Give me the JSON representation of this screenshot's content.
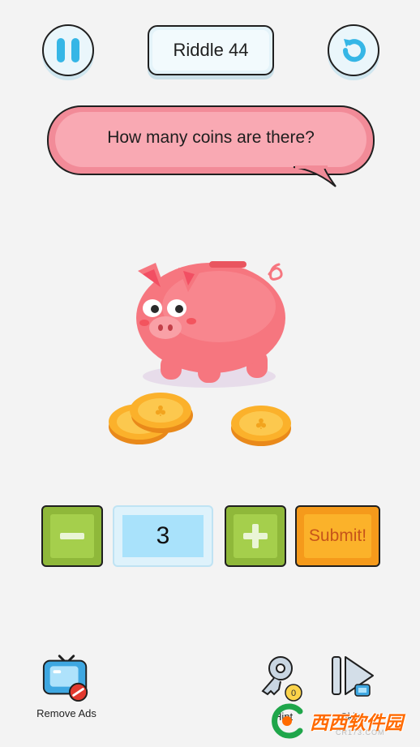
{
  "header": {
    "title": "Riddle 44"
  },
  "question": {
    "text": "How many coins are there?"
  },
  "answer": {
    "value": "3"
  },
  "controls": {
    "submit_label": "Submit!"
  },
  "bottom": {
    "remove_ads_label": "Remove Ads",
    "hint_label": "Hint",
    "hint_count": "0",
    "skip_label": "Skip"
  },
  "watermark": {
    "text": "西西软件园",
    "url": "CR173.COM"
  },
  "colors": {
    "background": "#f3f3f3",
    "accent_blue": "#35b6e6",
    "bubble_pink": "#f9a9b3",
    "button_green": "#a5cf4c",
    "submit_orange": "#fbb22a",
    "pig_pink": "#f6767f",
    "coin_gold": "#fbb12b"
  }
}
